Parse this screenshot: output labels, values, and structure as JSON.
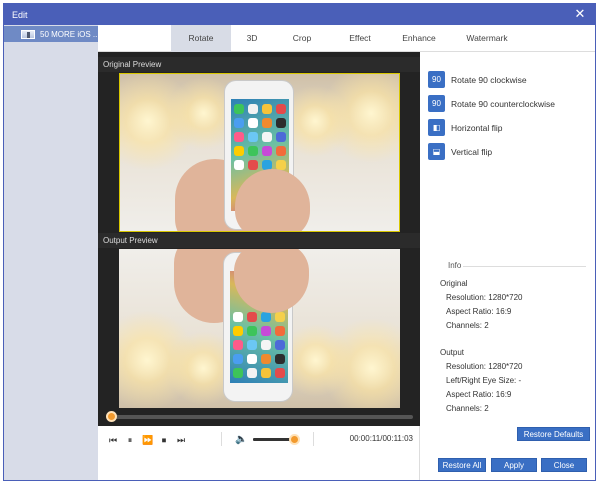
{
  "window": {
    "title": "Edit"
  },
  "sidebar": {
    "items": [
      {
        "label": "50 MORE iOS ..."
      }
    ]
  },
  "tabs": [
    {
      "label": "Rotate",
      "active": true
    },
    {
      "label": "3D"
    },
    {
      "label": "Crop"
    },
    {
      "label": "Effect"
    },
    {
      "label": "Enhance"
    },
    {
      "label": "Watermark"
    }
  ],
  "preview": {
    "original_label": "Original Preview",
    "output_label": "Output Preview"
  },
  "player": {
    "time": "00:00:11/00:11:03",
    "seek_progress": 0.0,
    "volume": 0.95,
    "icons": [
      "skip-back-icon",
      "pause-icon",
      "fast-forward-icon",
      "stop-icon",
      "skip-forward-icon",
      "volume-icon"
    ]
  },
  "actions": [
    {
      "label": "Rotate 90 clockwise",
      "icon": "rotate-cw-icon",
      "glyph": "90"
    },
    {
      "label": "Rotate 90 counterclockwise",
      "icon": "rotate-ccw-icon",
      "glyph": "90"
    },
    {
      "label": "Horizontal flip",
      "icon": "horizontal-flip-icon",
      "glyph": "◧"
    },
    {
      "label": "Vertical flip",
      "icon": "vertical-flip-icon",
      "glyph": "⬓"
    }
  ],
  "info": {
    "title": "Info",
    "original": {
      "heading": "Original",
      "resolution": "Resolution: 1280*720",
      "aspect": "Aspect Ratio: 16:9",
      "channels": "Channels: 2"
    },
    "output": {
      "heading": "Output",
      "resolution": "Resolution: 1280*720",
      "eye_size": "Left/Right Eye Size: -",
      "aspect": "Aspect Ratio: 16:9",
      "channels": "Channels: 2"
    }
  },
  "buttons": {
    "restore_defaults": "Restore Defaults",
    "restore_all": "Restore All",
    "apply": "Apply",
    "close": "Close"
  },
  "colors": {
    "titlebar": "#4a5fb8",
    "accent_button": "#3a6fc4",
    "knob": "#f29a2e",
    "sidebar_selected": "#6f8ac5"
  }
}
